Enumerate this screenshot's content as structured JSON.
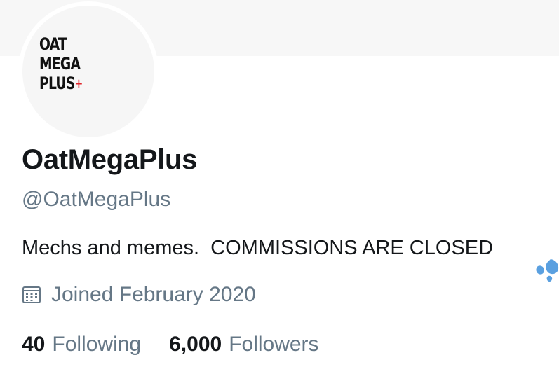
{
  "profile": {
    "avatar_logo_lines": [
      "OAT",
      "MEGA",
      "PLUS"
    ],
    "avatar_logo_plus": "+",
    "display_name": "OatMegaPlus",
    "handle": "@OatMegaPlus",
    "bio": "Mechs and memes.  COMMISSIONS ARE CLOSED",
    "bio_emoji_icon": "sweat-droplets-icon",
    "joined": "Joined February 2020",
    "joined_icon": "calendar-icon"
  },
  "stats": {
    "following_count": "40",
    "following_label": "Following",
    "followers_count": "6,000",
    "followers_label": "Followers"
  },
  "colors": {
    "primary_text": "#14171a",
    "secondary_text": "#657786",
    "accent": "#5aa0e0",
    "logo_red": "#e0262b"
  }
}
